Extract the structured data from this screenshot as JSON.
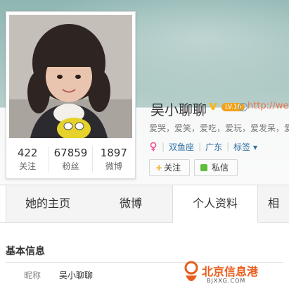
{
  "profile": {
    "name": "吴小聊聊",
    "level_badge": "LV.16",
    "homepage_url": "http://weibo",
    "interests": "爱哭，爱笑，爱吃，爱玩，爱发呆，爱",
    "zodiac": "双鱼座",
    "location": "广东",
    "tags_label": "标签",
    "tags_arrow": "▾"
  },
  "stats": [
    {
      "value": "422",
      "label": "关注"
    },
    {
      "value": "67859",
      "label": "粉丝"
    },
    {
      "value": "1897",
      "label": "微博"
    }
  ],
  "actions": {
    "follow_plus": "+",
    "follow_label": "关注",
    "message_label": "私信"
  },
  "tabs": [
    {
      "label": "她的主页"
    },
    {
      "label": "微博"
    },
    {
      "label": "个人资料"
    },
    {
      "label": "相"
    }
  ],
  "basic_info": {
    "title": "基本信息",
    "nickname_label": "昵称",
    "nickname_value": "吴小聊聊"
  },
  "watermark": {
    "text": "北京信息港",
    "sub": "BJXXG.COM"
  },
  "colors": {
    "accent": "#eb7350",
    "verified": "#f5b81c",
    "link": "#2f6fa3",
    "message_icon": "#5fbe3c"
  },
  "icons": {
    "verified": "verified-v-icon",
    "gender": "female-icon",
    "website": "globe-icon",
    "message": "message-icon",
    "tags_dropdown": "chevron-down-icon"
  }
}
